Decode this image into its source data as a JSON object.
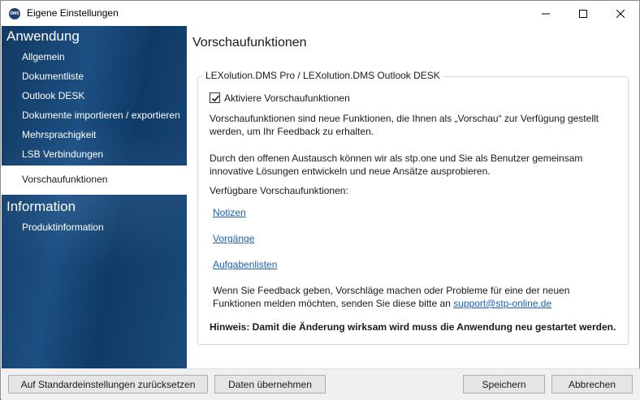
{
  "window": {
    "title": "Eigene Einstellungen",
    "app_icon_text": "DMS"
  },
  "sidebar": {
    "section_anwendung": "Anwendung",
    "items": [
      {
        "label": "Allgemein"
      },
      {
        "label": "Dokumentliste"
      },
      {
        "label": "Outlook DESK"
      },
      {
        "label": "Dokumente importieren / exportieren"
      },
      {
        "label": "Mehrsprachigkeit"
      },
      {
        "label": "LSB Verbindungen"
      }
    ],
    "selected_item": "Vorschaufunktionen",
    "section_information": "Information",
    "info_items": [
      {
        "label": "Produktinformation"
      }
    ]
  },
  "main": {
    "title": "Vorschaufunktionen",
    "group_label": "LEXolution.DMS Pro / LEXolution.DMS Outlook DESK",
    "checkbox_label": "Aktiviere Vorschaufunktionen",
    "checkbox_checked": true,
    "para1_line1": "Vorschaufunktionen sind neue Funktionen, die Ihnen als „Vorschau“ zur Verfügung gestellt",
    "para1_line2": "werden, um Ihr Feedback zu erhalten.",
    "para2_line1": "Durch den offenen Austausch können wir als stp.one und Sie als Benutzer gemeinsam",
    "para2_line2": "innovative Lösungen entwickeln und neue Ansätze ausprobieren.",
    "available_label": "Verfügbare Vorschaufunktionen:",
    "links": [
      "Notizen",
      "Vorgänge",
      "Aufgabenlisten"
    ],
    "feedback_line1": "Wenn Sie Feedback geben, Vorschläge machen oder Probleme für eine der neuen",
    "feedback_line2_prefix": "Funktionen melden möchten, senden Sie diese bitte an ",
    "feedback_email": "support@stp-online.de",
    "hint": "Hinweis: Damit die Änderung wirksam wird muss die Anwendung neu gestartet werden."
  },
  "footer": {
    "reset_label": "Auf Standardeinstellungen zurücksetzen",
    "apply_label": "Daten übernehmen",
    "save_label": "Speichern",
    "cancel_label": "Abbrechen"
  },
  "colors": {
    "link": "#1a5fb4",
    "sidebar_bg": "#1c4f82"
  }
}
